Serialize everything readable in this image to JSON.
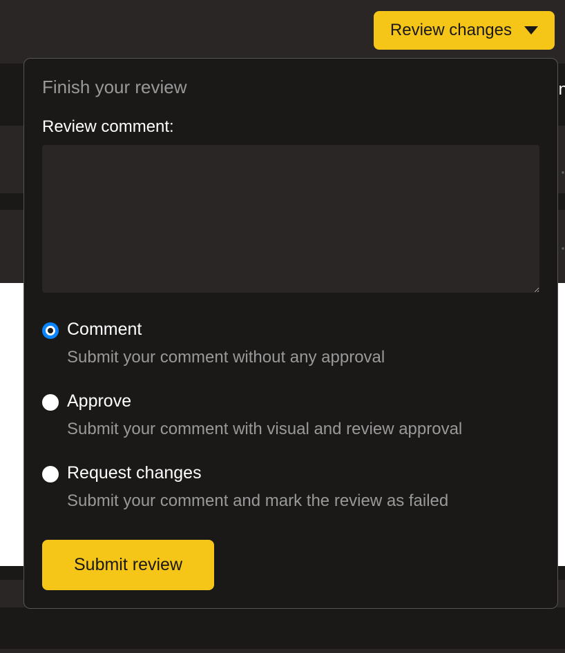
{
  "header": {
    "review_changes_label": "Review changes"
  },
  "popover": {
    "title": "Finish your review",
    "comment_label": "Review comment:",
    "comment_value": "",
    "options": [
      {
        "label": "Comment",
        "description": "Submit your comment without any approval",
        "selected": true
      },
      {
        "label": "Approve",
        "description": "Submit your comment with visual and review approval",
        "selected": false
      },
      {
        "label": "Request changes",
        "description": "Submit your comment and mark the review as failed",
        "selected": false
      }
    ],
    "submit_label": "Submit review"
  },
  "background": {
    "side_text": "in"
  }
}
